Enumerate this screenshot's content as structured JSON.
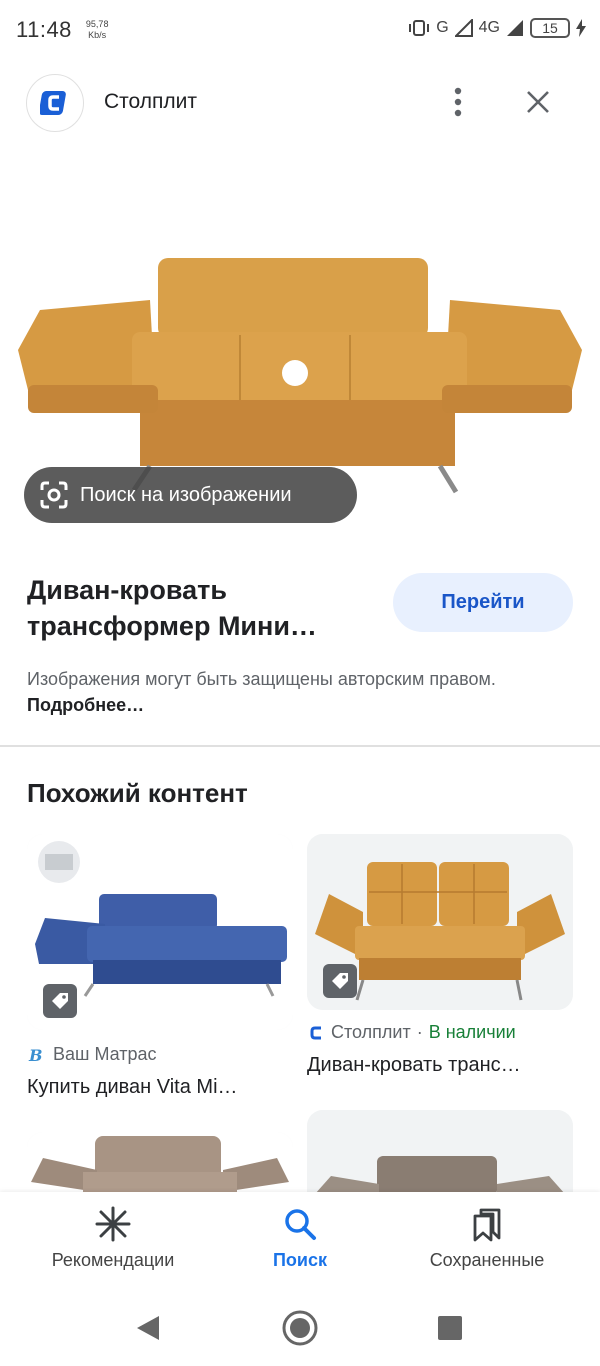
{
  "status_bar": {
    "time": "11:48",
    "speed_value": "95,78",
    "speed_unit": "Kb/s",
    "network_g": "G",
    "network_4g": "4G",
    "battery": "15"
  },
  "header": {
    "site_name": "Столплит",
    "logo_icon": "stolplit-logo",
    "more_icon": "more-vert-icon",
    "close_icon": "close-icon"
  },
  "main": {
    "lens_label": "Поиск на изображении",
    "title": "Диван-кровать трансформер Мини…",
    "go_button": "Перейти",
    "copyright_text": "Изображения могут быть защищены авторским правом.",
    "copyright_more": "Подробнее…"
  },
  "similar": {
    "heading": "Похожий контент",
    "cards": [
      {
        "source": "Ваш Матрас",
        "availability": "",
        "title": "Купить диван Vita Mi…"
      },
      {
        "source": "Столплит",
        "availability": "В наличии",
        "title": "Диван-кровать транс…"
      }
    ]
  },
  "bottom_nav": {
    "items": [
      {
        "label": "Рекомендации",
        "icon": "asterisk-icon"
      },
      {
        "label": "Поиск",
        "icon": "search-icon"
      },
      {
        "label": "Сохраненные",
        "icon": "bookmarks-icon"
      }
    ]
  },
  "colors": {
    "accent": "#1a73e8",
    "go_button_bg": "#e8f0fe",
    "available": "#188038",
    "sofa_orange": "#d69a43",
    "sofa_blue": "#3d5ea8"
  }
}
